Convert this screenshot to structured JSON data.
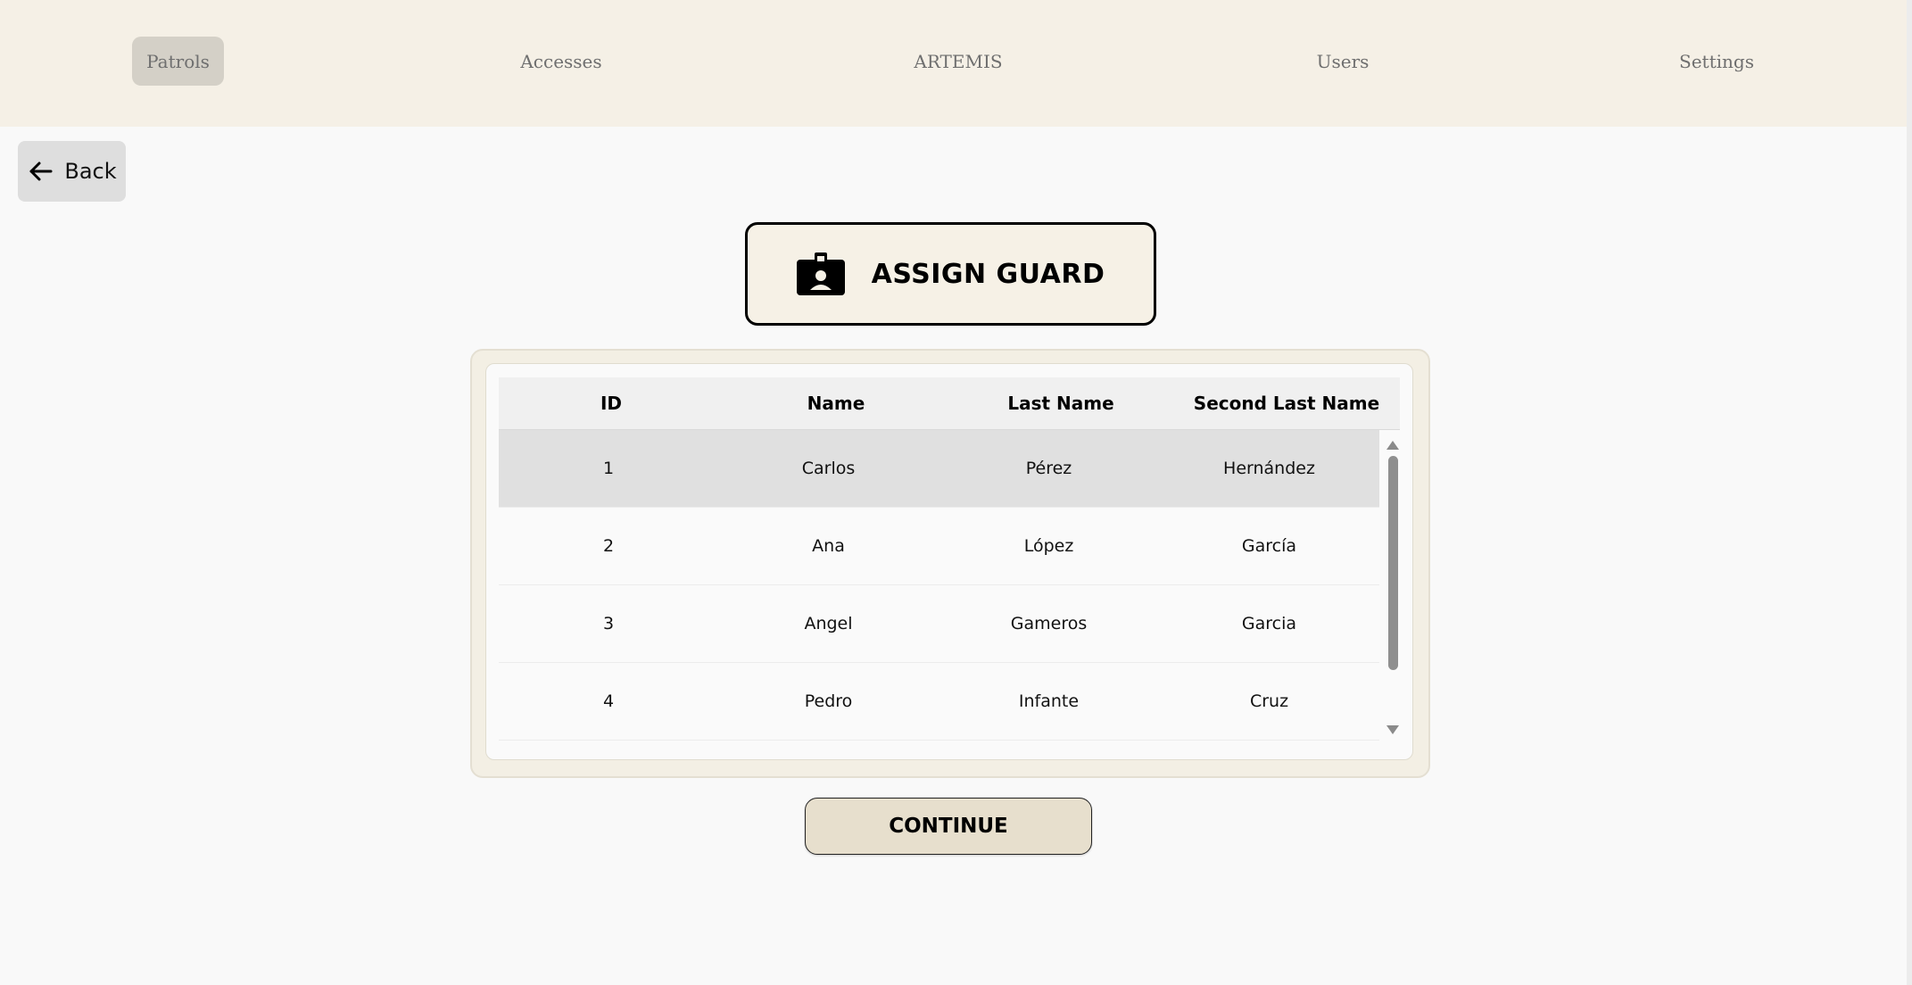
{
  "nav": {
    "items": [
      {
        "label": "Patrols",
        "active": true
      },
      {
        "label": "Accesses",
        "active": false
      },
      {
        "label": "ARTEMIS",
        "active": false
      },
      {
        "label": "Users",
        "active": false
      },
      {
        "label": "Settings",
        "active": false
      }
    ]
  },
  "back": {
    "label": "Back",
    "icon": "arrow-left-icon"
  },
  "assign": {
    "title": "ASSIGN GUARD",
    "icon": "id-badge-icon"
  },
  "table": {
    "columns": [
      "ID",
      "Name",
      "Last Name",
      "Second Last Name"
    ],
    "rows": [
      {
        "id": "1",
        "name": "Carlos",
        "last_name": "Pérez",
        "second_last_name": "Hernández",
        "selected": true
      },
      {
        "id": "2",
        "name": "Ana",
        "last_name": "López",
        "second_last_name": "García",
        "selected": false
      },
      {
        "id": "3",
        "name": "Angel",
        "last_name": "Gameros",
        "second_last_name": "Garcia",
        "selected": false
      },
      {
        "id": "4",
        "name": "Pedro",
        "last_name": "Infante",
        "second_last_name": "Cruz",
        "selected": false
      }
    ]
  },
  "continue": {
    "label": "CONTINUE"
  },
  "colors": {
    "header_bg": "#f5f0e6",
    "nav_active_bg": "#d4d0c7",
    "selected_row_bg": "#e0e0e0",
    "continue_bg": "#e7dfcd"
  }
}
